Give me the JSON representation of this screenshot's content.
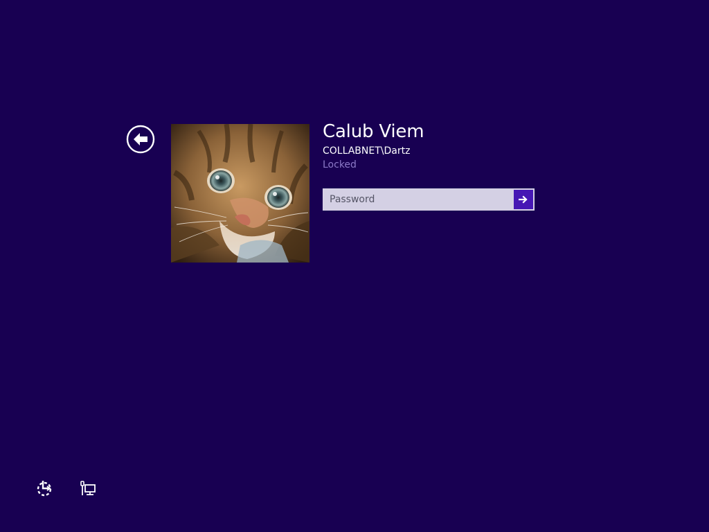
{
  "user": {
    "name": "Calub Viem",
    "domain_account": "COLLABNET\\Dartz",
    "status": "Locked"
  },
  "password": {
    "placeholder": "Password",
    "value": ""
  },
  "icons": {
    "back": "back-arrow-icon",
    "submit": "arrow-right-icon",
    "ease_of_access": "ease-of-access-icon",
    "network": "network-icon",
    "avatar": "kitten-photo"
  },
  "colors": {
    "background": "#180052",
    "submit_button": "#4617b4",
    "status_text": "#8c7ac8",
    "input_background": "#d4d0e4"
  }
}
